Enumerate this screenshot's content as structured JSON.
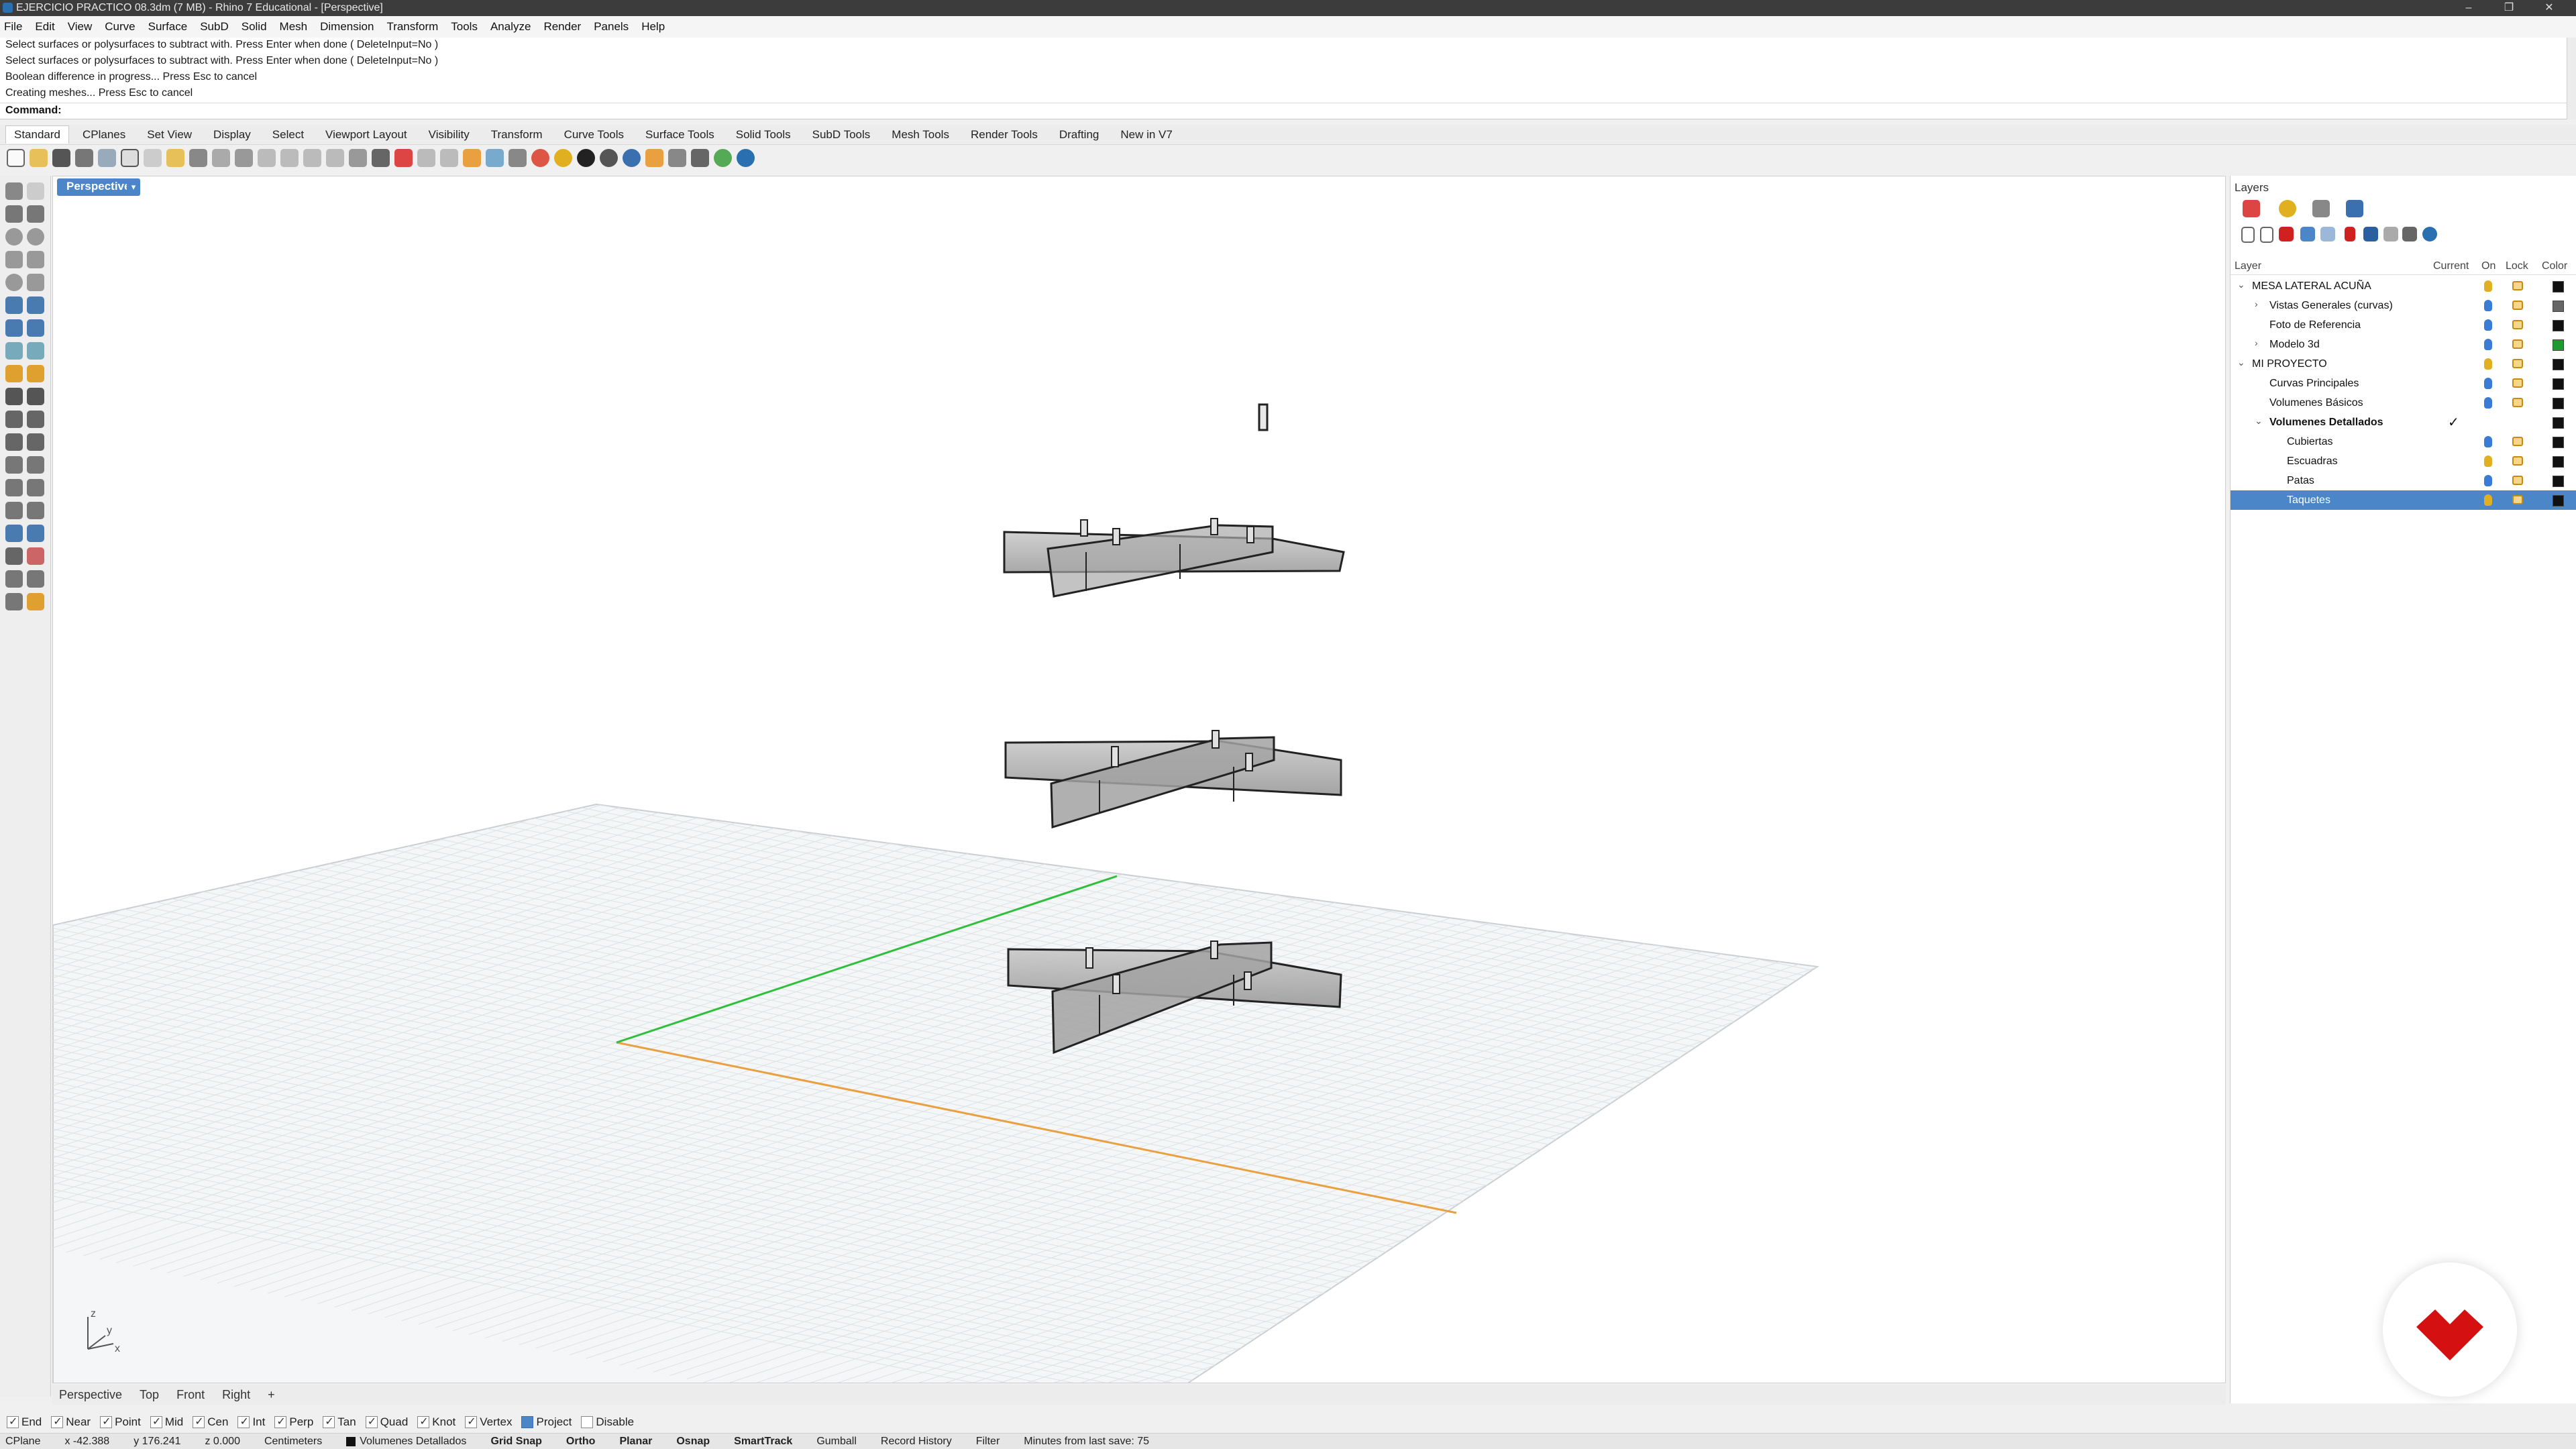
{
  "window": {
    "title": "EJERCICIO PRACTICO 08.3dm (7 MB) - Rhino 7 Educational - [Perspective]"
  },
  "menu": [
    "File",
    "Edit",
    "View",
    "Curve",
    "Surface",
    "SubD",
    "Solid",
    "Mesh",
    "Dimension",
    "Transform",
    "Tools",
    "Analyze",
    "Render",
    "Panels",
    "Help"
  ],
  "command_history": [
    "Select surfaces or polysurfaces to subtract with. Press Enter when done ( DeleteInput=No )",
    "Select surfaces or polysurfaces to subtract with. Press Enter when done ( DeleteInput=No )",
    "Boolean difference in progress... Press Esc to cancel",
    "Creating meshes... Press Esc to cancel"
  ],
  "command_prompt": "Command:",
  "toolbar_tabs": [
    "Standard",
    "CPlanes",
    "Set View",
    "Display",
    "Select",
    "Viewport Layout",
    "Visibility",
    "Transform",
    "Curve Tools",
    "Surface Tools",
    "Solid Tools",
    "SubD Tools",
    "Mesh Tools",
    "Render Tools",
    "Drafting",
    "New in V7"
  ],
  "viewport": {
    "label": "Perspective"
  },
  "viewport_tabs": [
    "Perspective",
    "Top",
    "Front",
    "Right",
    "+"
  ],
  "osnaps": [
    {
      "label": "End",
      "on": true
    },
    {
      "label": "Near",
      "on": true
    },
    {
      "label": "Point",
      "on": true
    },
    {
      "label": "Mid",
      "on": true
    },
    {
      "label": "Cen",
      "on": true
    },
    {
      "label": "Int",
      "on": true
    },
    {
      "label": "Perp",
      "on": true
    },
    {
      "label": "Tan",
      "on": true
    },
    {
      "label": "Quad",
      "on": true
    },
    {
      "label": "Knot",
      "on": true
    },
    {
      "label": "Vertex",
      "on": true
    },
    {
      "label": "Project",
      "on": true
    },
    {
      "label": "Disable",
      "on": false
    }
  ],
  "status": {
    "cplane": "CPlane",
    "x": "x -42.388",
    "y": "y 176.241",
    "z": "z 0.000",
    "units": "Centimeters",
    "layer": "Volumenes Detallados",
    "grid_snap": "Grid Snap",
    "ortho": "Ortho",
    "planar": "Planar",
    "osnap": "Osnap",
    "smarttrack": "SmartTrack",
    "gumball": "Gumball",
    "record_history": "Record History",
    "filter": "Filter",
    "save_info": "Minutes from last save: 75"
  },
  "layers_panel": {
    "title": "Layers",
    "columns": {
      "layer": "Layer",
      "current": "Current",
      "on": "On",
      "lock": "Lock",
      "color": "Color"
    },
    "rows": [
      {
        "name": "MESA LATERAL ACUÑA",
        "level": 0,
        "expand": "v",
        "bulb": "#e0b020",
        "color": "#111111"
      },
      {
        "name": "Vistas Generales (curvas)",
        "level": 1,
        "expand": ">",
        "bulb": "#3a7bd5",
        "color": "#666666"
      },
      {
        "name": "Foto de Referencia",
        "level": 1,
        "expand": "",
        "bulb": "#3a7bd5",
        "color": "#111111"
      },
      {
        "name": "Modelo 3d",
        "level": 1,
        "expand": ">",
        "bulb": "#3a7bd5",
        "color": "#1f9a2e"
      },
      {
        "name": "MI PROYECTO",
        "level": 0,
        "expand": "v",
        "bulb": "#e0b020",
        "color": "#111111"
      },
      {
        "name": "Curvas Principales",
        "level": 1,
        "expand": "",
        "bulb": "#3a7bd5",
        "color": "#111111"
      },
      {
        "name": "Volumenes Básicos",
        "level": 1,
        "expand": "",
        "bulb": "#3a7bd5",
        "color": "#111111"
      },
      {
        "name": "Volumenes Detallados",
        "level": 1,
        "expand": "v",
        "bulb": "",
        "color": "#111111",
        "current": true,
        "bold": true
      },
      {
        "name": "Cubiertas",
        "level": 2,
        "expand": "",
        "bulb": "#3a7bd5",
        "color": "#111111"
      },
      {
        "name": "Escuadras",
        "level": 2,
        "expand": "",
        "bulb": "#e0b020",
        "color": "#111111"
      },
      {
        "name": "Patas",
        "level": 2,
        "expand": "",
        "bulb": "#3a7bd5",
        "color": "#111111"
      },
      {
        "name": "Taquetes",
        "level": 2,
        "expand": "",
        "bulb": "#e0b020",
        "color": "#111111",
        "selected": true
      }
    ]
  },
  "colors": {
    "accent": "#4a86c8",
    "x_axis": "#e8a040",
    "y_axis": "#2fbf3a",
    "logo": "#d41010"
  },
  "icons": [
    "new-file-icon",
    "open-icon",
    "save-icon",
    "print-icon",
    "cut-icon",
    "copy-icon",
    "paste-icon",
    "undo-icon",
    "pan-icon",
    "zoom-icon",
    "render-icon",
    "help-icon"
  ]
}
